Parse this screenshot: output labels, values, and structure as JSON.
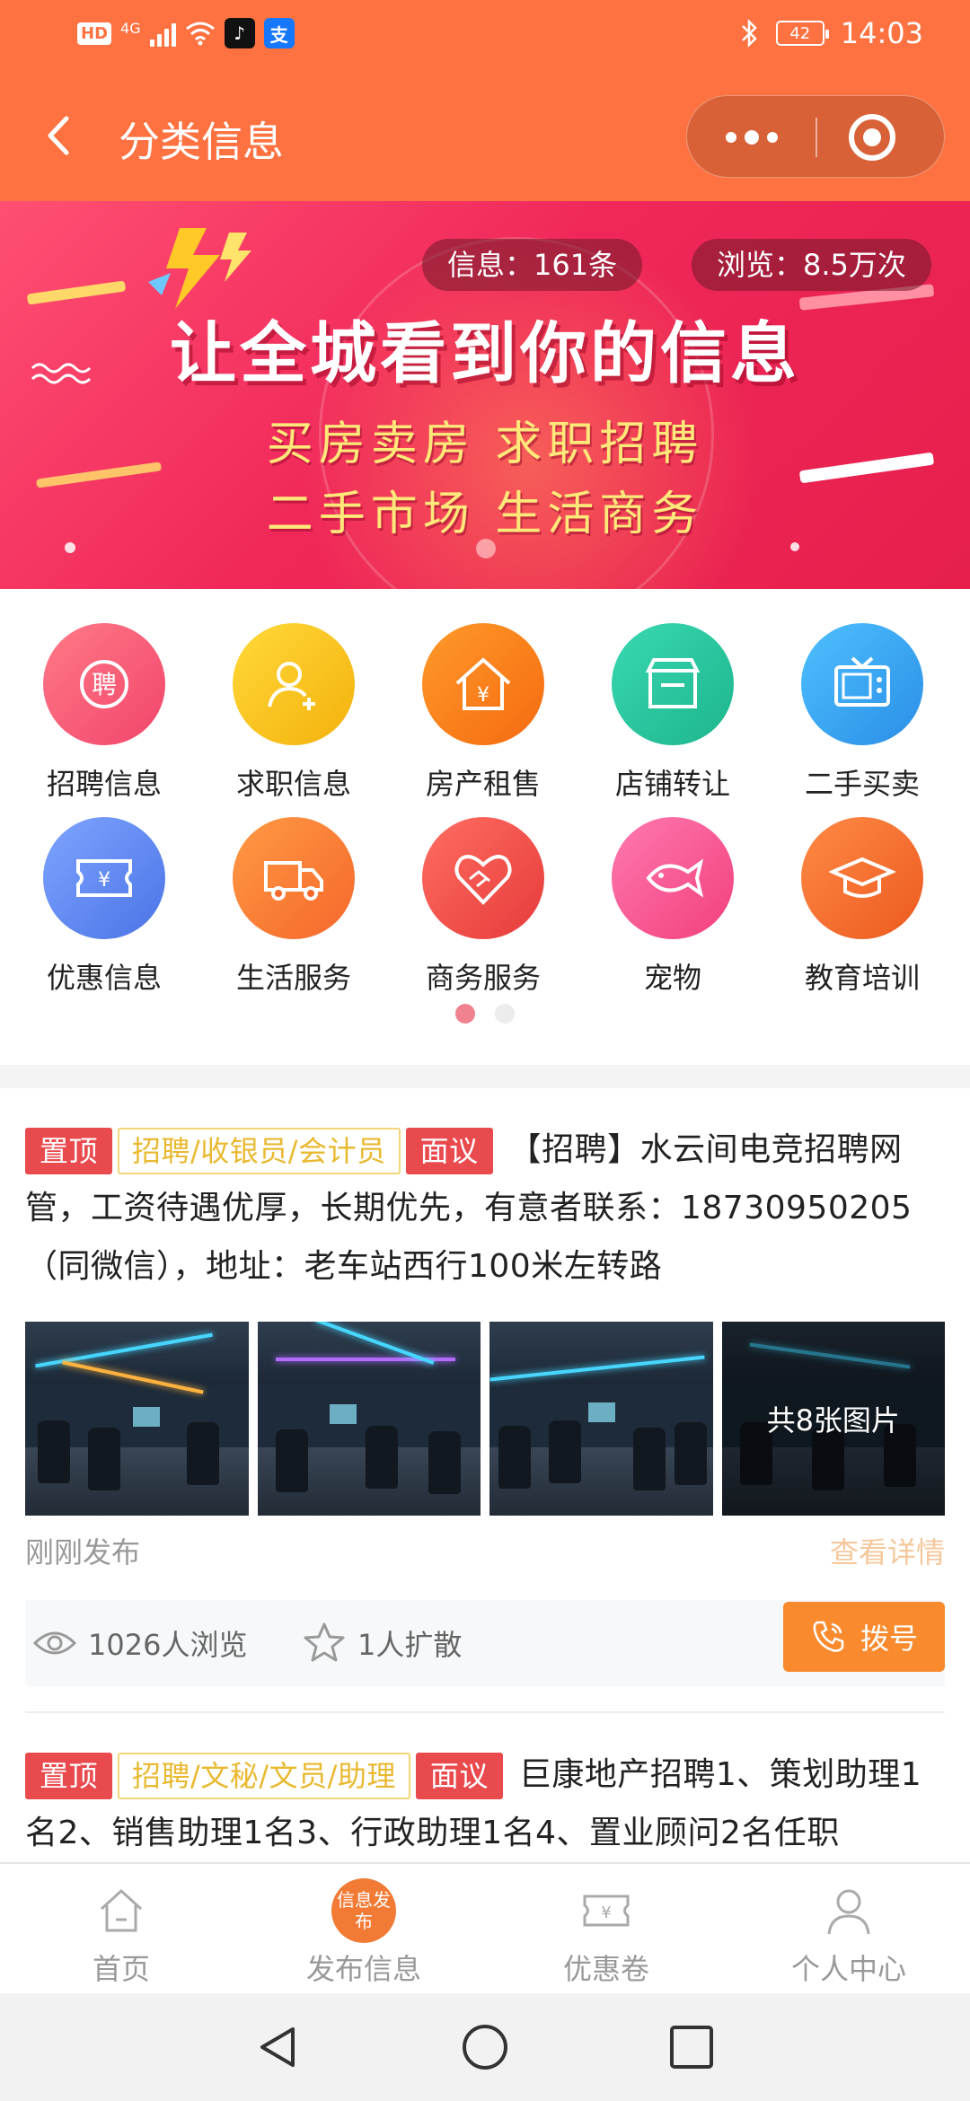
{
  "status_bar": {
    "hd": "HD",
    "network": "4G",
    "battery": "42",
    "time": "14:03"
  },
  "navbar": {
    "title": "分类信息"
  },
  "banner": {
    "info_count": "信息：161条",
    "views": "浏览：8.5万次",
    "headline": "让全城看到你的信息",
    "line1": "买房卖房  求职招聘",
    "line2": "二手市场  生活商务"
  },
  "categories": [
    {
      "label": "招聘信息",
      "icon": "recruit-icon",
      "color": "#f45a6c"
    },
    {
      "label": "求职信息",
      "icon": "job-seeker-icon",
      "color": "#f7c11b"
    },
    {
      "label": "房产租售",
      "icon": "house-icon",
      "color": "#fb7d1e"
    },
    {
      "label": "店铺转让",
      "icon": "shop-icon",
      "color": "#2cc8a0"
    },
    {
      "label": "二手买卖",
      "icon": "tv-icon",
      "color": "#3ea5f0"
    },
    {
      "label": "优惠信息",
      "icon": "coupon-icon",
      "color": "#5f8cf2"
    },
    {
      "label": "生活服务",
      "icon": "truck-icon",
      "color": "#fb7d2d"
    },
    {
      "label": "商务服务",
      "icon": "handshake-icon",
      "color": "#f0524b"
    },
    {
      "label": "宠物",
      "icon": "fish-icon",
      "color": "#f7578f"
    },
    {
      "label": "教育培训",
      "icon": "graduation-cap-icon",
      "color": "#f46a2c"
    }
  ],
  "posts": [
    {
      "tag_top": "置顶",
      "category": "招聘/收银员/会计员",
      "salary": "面议",
      "text": "【招聘】水云间电竞招聘网管，工资待遇优厚，长期优先，有意者联系：18730950205（同微信），地址：老车站西行100米左转路",
      "image_count": "共8张图片",
      "time": "刚刚发布",
      "detail": "查看详情",
      "views": "1026人浏览",
      "shares": "1人扩散",
      "dial": "拨号"
    },
    {
      "tag_top": "置顶",
      "category": "招聘/文秘/文员/助理",
      "salary": "面议",
      "text": "巨康地产招聘1、策划助理1名2、销售助理1名3、行政助理1名4、置业顾问2名任职"
    }
  ],
  "tabbar": [
    {
      "label": "首页",
      "icon": "home-icon"
    },
    {
      "label": "发布信息",
      "icon_text": "信息发布",
      "icon": "publish-icon"
    },
    {
      "label": "优惠卷",
      "icon": "coupon-icon"
    },
    {
      "label": "个人中心",
      "icon": "user-icon"
    }
  ]
}
